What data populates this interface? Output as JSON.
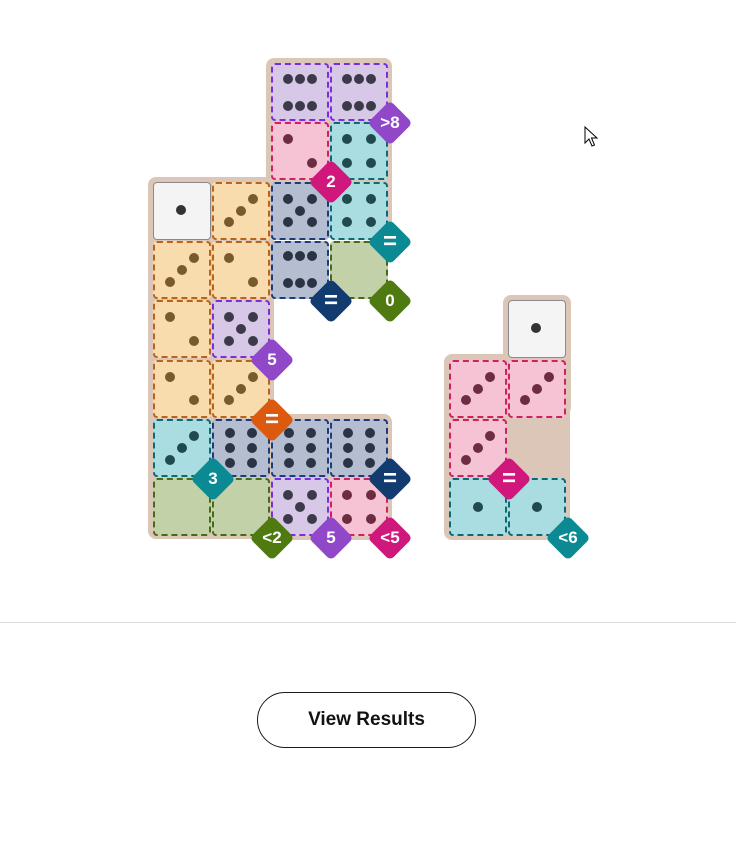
{
  "cells": [
    {
      "c": "e",
      "r": 0,
      "pips": 6,
      "region": "purple"
    },
    {
      "c": "f",
      "r": 0,
      "pips": 6,
      "region": "purple"
    },
    {
      "c": "e",
      "r": 1,
      "pips": 2,
      "region": "pink"
    },
    {
      "c": "f",
      "r": 1,
      "pips": 4,
      "region": "teal"
    },
    {
      "c": "a",
      "r": 2,
      "pips": 1,
      "region": "none"
    },
    {
      "c": "b",
      "r": 2,
      "pips": 3,
      "region": "orange"
    },
    {
      "c": "e",
      "r": 2,
      "pips": 5,
      "region": "navy"
    },
    {
      "c": "f",
      "r": 2,
      "pips": 4,
      "region": "teal"
    },
    {
      "c": "a",
      "r": 3,
      "pips": 3,
      "region": "orange"
    },
    {
      "c": "b",
      "r": 3,
      "pips": 2,
      "region": "orange"
    },
    {
      "c": "e",
      "r": 3,
      "pips": 6,
      "region": "navy"
    },
    {
      "c": "f",
      "r": 3,
      "pips": 0,
      "region": "green"
    },
    {
      "c": "a",
      "r": 4,
      "pips": 2,
      "region": "orange"
    },
    {
      "c": "b",
      "r": 4,
      "pips": 5,
      "region": "purple"
    },
    {
      "c": "i",
      "r": 4,
      "pips": 1,
      "region": "none"
    },
    {
      "c": "a",
      "r": 5,
      "pips": 2,
      "region": "orange"
    },
    {
      "c": "b",
      "r": 5,
      "pips": 3,
      "region": "orange"
    },
    {
      "c": "h",
      "r": 5,
      "pips": 3,
      "region": "pink"
    },
    {
      "c": "i",
      "r": 5,
      "pips": 3,
      "region": "pink"
    },
    {
      "c": "a",
      "r": 6,
      "pips": 3,
      "region": "teal"
    },
    {
      "c": "b",
      "r": 6,
      "pips": 6,
      "region": "navy"
    },
    {
      "c": "d",
      "r": 6,
      "pips": 6,
      "region": "navy"
    },
    {
      "c": "f",
      "r": 6,
      "pips": 6,
      "region": "navy"
    },
    {
      "c": "h",
      "r": 6,
      "pips": 3,
      "region": "pink"
    },
    {
      "c": "a",
      "r": 7,
      "pips": 0,
      "region": "green"
    },
    {
      "c": "b",
      "r": 7,
      "pips": 0,
      "region": "green"
    },
    {
      "c": "d",
      "r": 7,
      "pips": 5,
      "region": "purple"
    },
    {
      "c": "f",
      "r": 7,
      "pips": 4,
      "region": "pink"
    },
    {
      "c": "h",
      "r": 7,
      "pips": 1,
      "region": "teal"
    },
    {
      "c": "i",
      "r": 7,
      "pips": 1,
      "region": "teal"
    }
  ],
  "badges": [
    {
      "label": ">8",
      "color": "#9048c8",
      "c": "f",
      "r": 0
    },
    {
      "label": "2",
      "color": "#d0187c",
      "c": "e",
      "r": 1
    },
    {
      "label": "=",
      "color": "#0b8a94",
      "c": "f",
      "r": 2
    },
    {
      "label": "=",
      "color": "#123c70",
      "c": "e",
      "r": 3
    },
    {
      "label": "0",
      "color": "#4f7a10",
      "c": "f",
      "r": 3
    },
    {
      "label": "5",
      "color": "#9048c8",
      "c": "b",
      "r": 4
    },
    {
      "label": "=",
      "color": "#dc5a10",
      "c": "b",
      "r": 5
    },
    {
      "label": "3",
      "color": "#0b8a94",
      "c": "a",
      "r": 6
    },
    {
      "label": "=",
      "color": "#123c70",
      "c": "f",
      "r": 6
    },
    {
      "label": "<2",
      "color": "#4f7a10",
      "c": "b",
      "r": 7
    },
    {
      "label": "5",
      "color": "#9048c8",
      "c": "d",
      "r": 7
    },
    {
      "label": "<5",
      "color": "#d0187c",
      "c": "f",
      "r": 7
    },
    {
      "label": "=",
      "color": "#d0187c",
      "c": "h",
      "r": 6
    },
    {
      "label": "<6",
      "color": "#0b8a94",
      "c": "i",
      "r": 7
    }
  ],
  "palette": {
    "none": {
      "fill": "#f4f4f4",
      "stroke": "none",
      "pip": "#333333"
    },
    "orange": {
      "fill": "#f8dcae",
      "stroke": "#b9641e",
      "pip": "#7a5a2c"
    },
    "purple": {
      "fill": "#d6c8e6",
      "stroke": "#7a2ee0",
      "pip": "#3c3a4a"
    },
    "pink": {
      "fill": "#f5c3d4",
      "stroke": "#d0205f",
      "pip": "#6e2c40"
    },
    "teal": {
      "fill": "#a9dde2",
      "stroke": "#0d6a70",
      "pip": "#1f4a4e"
    },
    "navy": {
      "fill": "#b4bed0",
      "stroke": "#1e3c7a",
      "pip": "#2a3444"
    },
    "green": {
      "fill": "#c3d1a8",
      "stroke": "#466a18",
      "pip": "#2f3f18"
    },
    "board": "#dcc6b8"
  },
  "button": {
    "label": "View Results"
  }
}
